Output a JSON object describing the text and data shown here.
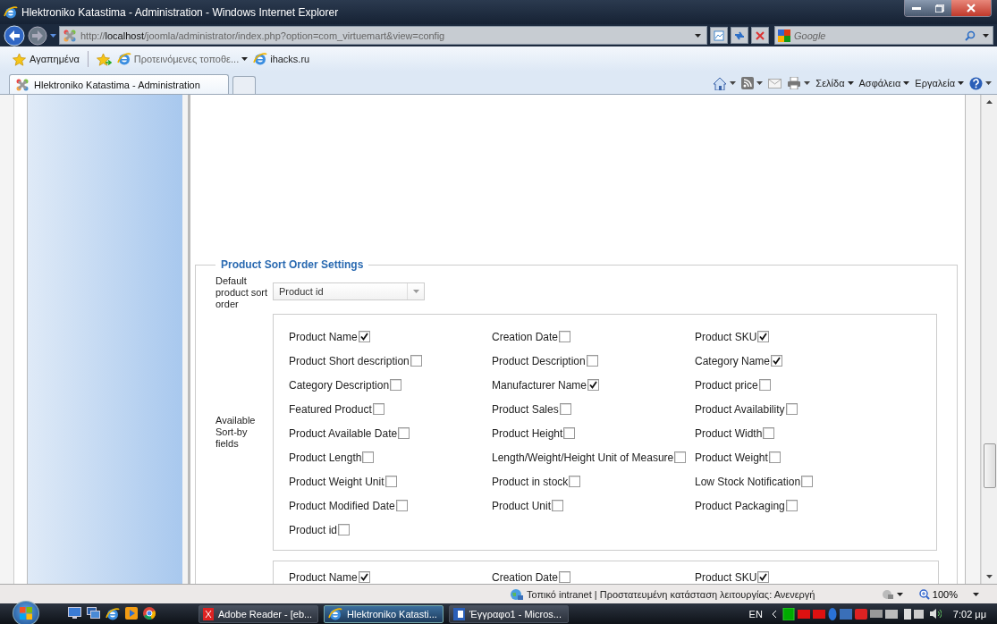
{
  "window": {
    "title": "Hlektroniko Katastima - Administration - Windows Internet Explorer"
  },
  "address_bar": {
    "url_prefix": "http://",
    "url_host": "localhost",
    "url_path": "/joomla/administrator/index.php?option=com_virtuemart&view=config"
  },
  "search": {
    "placeholder": "Google"
  },
  "favorites_bar": {
    "favorites": "Αγαπημένα",
    "links": [
      "Προτεινόμενες τοποθε...",
      "ihacks.ru"
    ]
  },
  "tabs": [
    {
      "label": "Hlektroniko Katastima - Administration",
      "selected": true
    }
  ],
  "command_bar": [
    "Σελίδα",
    "Ασφάλεια",
    "Εργαλεία"
  ],
  "sort_settings": {
    "legend": "Product Sort Order Settings",
    "default_label": "Default product sort order",
    "default_value": "Product id",
    "fields_label": "Available Sort-by fields",
    "fields": [
      {
        "label": "Product Name",
        "checked": true
      },
      {
        "label": "Creation Date",
        "checked": false
      },
      {
        "label": "Product SKU",
        "checked": true
      },
      {
        "label": "Product Short description",
        "checked": false
      },
      {
        "label": "Product Description",
        "checked": false
      },
      {
        "label": "Category Name",
        "checked": true
      },
      {
        "label": "Category Description",
        "checked": false
      },
      {
        "label": "Manufacturer Name",
        "checked": true
      },
      {
        "label": "Product price",
        "checked": false
      },
      {
        "label": "Featured Product",
        "checked": false
      },
      {
        "label": "Product Sales",
        "checked": false
      },
      {
        "label": "Product Availability",
        "checked": false
      },
      {
        "label": "Product Available Date",
        "checked": false
      },
      {
        "label": "Product Height",
        "checked": false
      },
      {
        "label": "Product Width",
        "checked": false
      },
      {
        "label": "Product Length",
        "checked": false
      },
      {
        "label": "Length/Weight/Height Unit of Measure",
        "checked": false
      },
      {
        "label": "Product Weight",
        "checked": false
      },
      {
        "label": "Product Weight Unit",
        "checked": false
      },
      {
        "label": "Product in stock",
        "checked": false
      },
      {
        "label": "Low Stock Notification",
        "checked": false
      },
      {
        "label": "Product Modified Date",
        "checked": false
      },
      {
        "label": "Product Unit",
        "checked": false
      },
      {
        "label": "Product Packaging",
        "checked": false
      },
      {
        "label": "Product id",
        "checked": false
      }
    ],
    "next_group_fields": [
      {
        "label": "Product Name",
        "checked": true
      },
      {
        "label": "Creation Date",
        "checked": false
      },
      {
        "label": "Product SKU",
        "checked": true
      }
    ]
  },
  "status_bar": {
    "zone": "Τοπικό intranet | Προστατευμένη κατάσταση λειτουργίας: Ανενεργή",
    "zoom": "100%"
  },
  "taskbar": {
    "windows": [
      {
        "label": "Adobe Reader - [eb...",
        "selected": false
      },
      {
        "label": "Hlektroniko Katasti...",
        "selected": true
      },
      {
        "label": "Έγγραφο1 - Micros...",
        "selected": false
      }
    ],
    "language": "EN",
    "clock": "7:02 μμ"
  }
}
